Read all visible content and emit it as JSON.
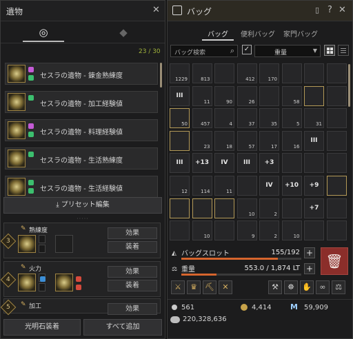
{
  "relics": {
    "title": "遺物",
    "close": "✕",
    "tab_icons": [
      "relic-tab-icon",
      "crystal-tab-icon"
    ],
    "count": "23 / 30",
    "items": [
      {
        "name": "セスラの遺物 - 錬金熟練度"
      },
      {
        "name": "セスラの遺物 - 加工経験値"
      },
      {
        "name": "セスラの遺物 - 料理経験値"
      },
      {
        "name": "セスラの遺物 - 生活熟練度"
      },
      {
        "name": "セスラの遺物 - 生活経験値"
      }
    ],
    "preset_button": "プリセット編集",
    "equipped": [
      {
        "number": "3",
        "label": "熟練度",
        "btn1": "効果",
        "btn2": "装着"
      },
      {
        "number": "4",
        "label": "火力",
        "btn1": "効果",
        "btn2": "装着"
      },
      {
        "number": "5",
        "label": "加工",
        "btn1": "効果",
        "btn2": ""
      }
    ],
    "bottom_buttons": [
      "光明石装着",
      "すべて追加"
    ]
  },
  "bag": {
    "title": "バッグ",
    "icons": [
      "bag-icon",
      "help-icon",
      "pin-icon",
      "close-icon"
    ],
    "help": "?",
    "close": "✕",
    "tabs": [
      "バッグ",
      "便利バッグ",
      "家門バッグ"
    ],
    "search_placeholder": "バッグ検索",
    "sort_label": "重量",
    "cells": [
      {
        "count": "1229"
      },
      {
        "count": "813"
      },
      {
        "count": ""
      },
      {
        "count": "412"
      },
      {
        "count": "170"
      },
      {
        "count": ""
      },
      {
        "count": ""
      },
      {
        "count": ""
      },
      {
        "label": "III"
      },
      {
        "count": "11"
      },
      {
        "count": "90"
      },
      {
        "count": "26"
      },
      {
        "count": ""
      },
      {
        "count": "58"
      },
      {
        "count": ""
      },
      {
        "count": ""
      },
      {
        "count": "50"
      },
      {
        "count": "457"
      },
      {
        "count": "4"
      },
      {
        "count": "37"
      },
      {
        "count": "35"
      },
      {
        "count": "5"
      },
      {
        "count": "31"
      },
      {
        "count": ""
      },
      {
        "count": ""
      },
      {
        "count": "23"
      },
      {
        "count": "18"
      },
      {
        "count": "57"
      },
      {
        "count": "17"
      },
      {
        "count": "16"
      },
      {
        "label": "III"
      },
      {
        "count": ""
      },
      {
        "label": "III"
      },
      {
        "label": "+13"
      },
      {
        "label": "IV"
      },
      {
        "label": "III"
      },
      {
        "label": "+3"
      },
      {
        "count": ""
      },
      {
        "count": ""
      },
      {
        "count": ""
      },
      {
        "count": "12"
      },
      {
        "count": "114"
      },
      {
        "count": "11"
      },
      {
        "count": ""
      },
      {
        "label": "IV"
      },
      {
        "label": "+10"
      },
      {
        "label": "+9"
      },
      {
        "count": ""
      },
      {
        "count": ""
      },
      {
        "count": ""
      },
      {
        "count": ""
      },
      {
        "count": "10"
      },
      {
        "count": "2"
      },
      {
        "count": ""
      },
      {
        "label": "+7"
      },
      {
        "count": ""
      },
      {
        "count": ""
      },
      {
        "count": "10"
      },
      {
        "count": ""
      },
      {
        "count": "9"
      },
      {
        "count": "2"
      },
      {
        "count": "10"
      },
      {
        "count": ""
      },
      {
        "count": ""
      }
    ],
    "slot_label": "バッグスロット",
    "slot_value": "155/192",
    "slot_fraction": 0.807,
    "weight_label": "重量",
    "weight_value": "553.0 / 1,874 LT",
    "weight_fraction": 0.295,
    "silver_small": "561",
    "coins": "4,414",
    "m_points": "59,909",
    "silver_total": "220,328,636"
  }
}
